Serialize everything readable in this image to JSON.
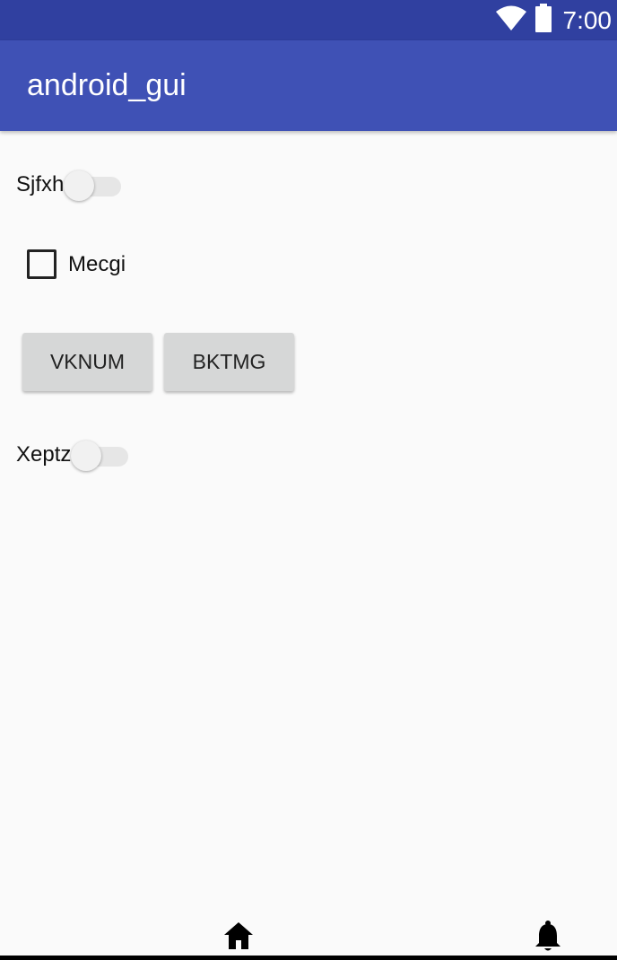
{
  "status_bar": {
    "time": "7:00",
    "icons": [
      "wifi-icon",
      "battery-icon"
    ],
    "color": "#3040a0"
  },
  "app_bar": {
    "title": "android_gui",
    "color": "#3f51b5"
  },
  "content": {
    "switch_1": {
      "label": "Sjfxh",
      "checked": false
    },
    "checkbox_1": {
      "label": "Mecgi",
      "checked": false
    },
    "buttons": [
      {
        "label": "VKNUM"
      },
      {
        "label": "BKTMG"
      }
    ],
    "switch_2": {
      "label": "Xeptz",
      "checked": false
    }
  },
  "nav_bar": {
    "icons": [
      "home-icon",
      "bell-icon"
    ]
  }
}
